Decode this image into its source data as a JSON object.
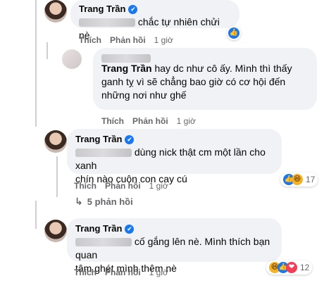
{
  "comments": [
    {
      "author": "Trang Trần",
      "text": "chắc tự nhiên chửi nè",
      "actions": {
        "like": "Thích",
        "reply": "Phản hồi",
        "time": "1 giờ"
      }
    },
    {
      "author": "Trang Trần",
      "text_line1": "hay dc như cô ấy. Mình thì thấy",
      "text_line2": "ganh tỵ vì sẽ chẳng bao giờ có cơ hội đến",
      "text_line3": "những nơi như ghế",
      "actions": {
        "like": "Thích",
        "reply": "Phản hồi",
        "time": "1 giờ"
      }
    },
    {
      "author": "Trang Trần",
      "text_line1": "dùng nick thật cm một lần cho xanh",
      "text_line2": "chín nào cuộn con cay cú",
      "actions": {
        "like": "Thích",
        "reply": "Phản hồi",
        "time": "1 giờ"
      },
      "reaction_count": "17",
      "replies_label": "5 phản hồi"
    },
    {
      "author": "Trang Trần",
      "text_line1": "cố gắng lên nè. Mình thích bạn quan",
      "text_line2": "tâm ghét mình thêm nè",
      "actions": {
        "like": "Thích",
        "reply": "Phản hồi",
        "time": "1 giờ"
      },
      "reaction_count": "12"
    }
  ],
  "icons": {
    "verified": "✔",
    "like": "👍",
    "haha": "😆",
    "love": "❤",
    "reply_arrow": "↳"
  },
  "colors": {
    "brand": "#1877f2",
    "bubble": "#f0f2f5",
    "muted": "#65676b"
  }
}
